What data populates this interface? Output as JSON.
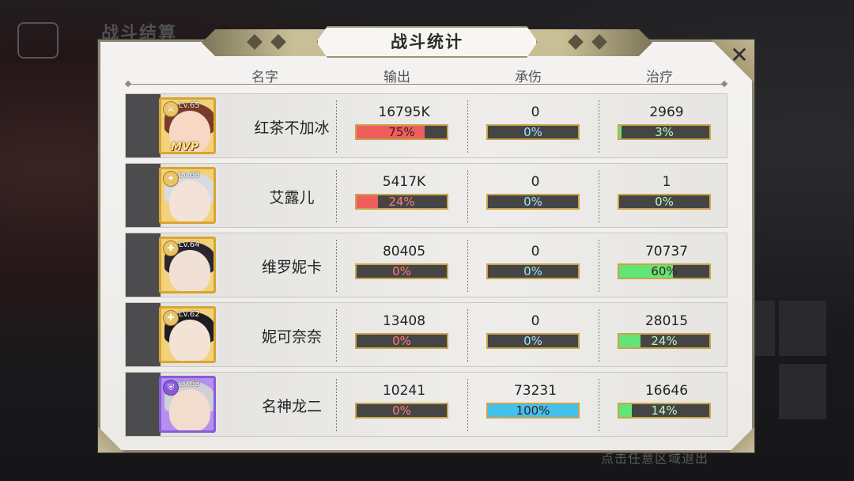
{
  "background": {
    "title": "战斗结算",
    "hint": "点击任意区域退出"
  },
  "panel": {
    "title": "战斗统计",
    "close_icon": "✕"
  },
  "headers": {
    "name": "名字",
    "output": "输出",
    "tank": "承伤",
    "heal": "治疗"
  },
  "colors": {
    "output_bar": "#ef5d5d",
    "tank_bar": "#43c1ec",
    "heal_bar": "#63e476",
    "frame_gold": "#c9a449"
  },
  "rows": [
    {
      "level": "Lv.65",
      "class_icon": "sword-icon",
      "mvp": "MVP",
      "name": "红茶不加冰",
      "output": "16795K",
      "output_pct": "75%",
      "output_frac": 0.75,
      "tank": "0",
      "tank_pct": "0%",
      "tank_frac": 0,
      "heal": "2969",
      "heal_pct": "3%",
      "heal_frac": 0.03
    },
    {
      "level": "Lv.63",
      "class_icon": "mage-icon",
      "mvp": "",
      "name": "艾露儿",
      "output": "5417K",
      "output_pct": "24%",
      "output_frac": 0.24,
      "tank": "0",
      "tank_pct": "0%",
      "tank_frac": 0,
      "heal": "1",
      "heal_pct": "0%",
      "heal_frac": 0
    },
    {
      "level": "Lv.64",
      "class_icon": "healer-icon",
      "mvp": "",
      "name": "维罗妮卡",
      "output": "80405",
      "output_pct": "0%",
      "output_frac": 0,
      "tank": "0",
      "tank_pct": "0%",
      "tank_frac": 0,
      "heal": "70737",
      "heal_pct": "60%",
      "heal_frac": 0.6
    },
    {
      "level": "Lv.62",
      "class_icon": "healer-icon",
      "mvp": "",
      "name": "妮可奈奈",
      "output": "13408",
      "output_pct": "0%",
      "output_frac": 0,
      "tank": "0",
      "tank_pct": "0%",
      "tank_frac": 0,
      "heal": "28015",
      "heal_pct": "24%",
      "heal_frac": 0.24
    },
    {
      "level": "Lv.63",
      "class_icon": "shield-icon",
      "mvp": "",
      "name": "名神龙二",
      "output": "10241",
      "output_pct": "0%",
      "output_frac": 0,
      "tank": "73231",
      "tank_pct": "100%",
      "tank_frac": 1.0,
      "heal": "16646",
      "heal_pct": "14%",
      "heal_frac": 0.14
    }
  ]
}
